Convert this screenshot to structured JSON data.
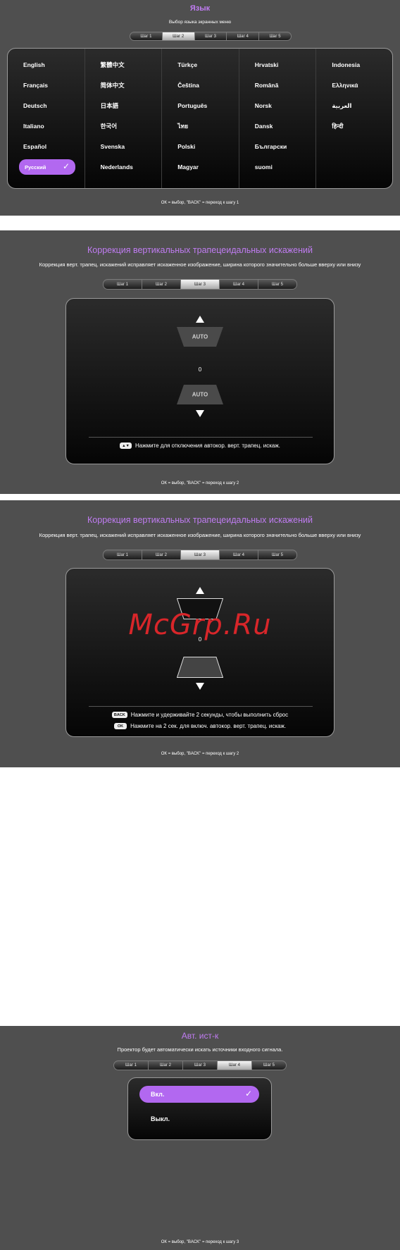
{
  "language_screen": {
    "title": "Язык",
    "subtitle": "Выбор языка экранных меню",
    "steps": [
      "Шаг 1",
      "Шаг 2",
      "Шаг 3",
      "Шаг 4",
      "Шаг 5"
    ],
    "active_step": 2,
    "columns": [
      [
        "English",
        "Français",
        "Deutsch",
        "Italiano",
        "Español",
        "Русский"
      ],
      [
        "繁體中文",
        "简体中文",
        "日本語",
        "한국어",
        "Svenska",
        "Nederlands"
      ],
      [
        "Türkçe",
        "Čeština",
        "Português",
        "ไทย",
        "Polski",
        "Magyar"
      ],
      [
        "Hrvatski",
        "Română",
        "Norsk",
        "Dansk",
        "Български",
        "suomi"
      ],
      [
        "Indonesia",
        "Ελληνικά",
        "العربية",
        "हिन्दी",
        "",
        ""
      ]
    ],
    "selected_language": "Русский",
    "footer": "ОК = выбор, \"BACK\" = переход к шагу 1"
  },
  "keystone_auto_screen": {
    "title": "Коррекция вертикальных трапецеидальных искажений",
    "subtitle": "Коррекция верт. трапец. искажений исправляет искаженное изображение, ширина которого значительно больше вверху или внизу",
    "steps": [
      "Шаг 1",
      "Шаг 2",
      "Шаг 3",
      "Шаг 4",
      "Шаг 5"
    ],
    "active_step": 3,
    "auto_top": "AUTO",
    "auto_bottom": "AUTO",
    "value": "0",
    "hint": "Нажмите для отключения автокор. верт. трапец. искаж.",
    "footer": "ОК = выбор, \"BACK\" = переход к шагу 2"
  },
  "keystone_manual_screen": {
    "title": "Коррекция вертикальных трапецеидальных искажений",
    "subtitle": "Коррекция верт. трапец. искажений исправляет искаженное изображение, ширина которого значительно больше вверху или внизу",
    "steps": [
      "Шаг 1",
      "Шаг 2",
      "Шаг 3",
      "Шаг 4",
      "Шаг 5"
    ],
    "active_step": 3,
    "value": "0",
    "watermark": "McGrp.Ru",
    "hint_back_key": "BACK",
    "hint_back": "Нажмите и удерживайте 2 секунды, чтобы выполнить сброс",
    "hint_ok_key": "OK",
    "hint_ok": "Нажмите на 2 сек. для включ. автокор. верт. трапец. искаж.",
    "footer": "ОК = выбор, \"BACK\" = переход к шагу 2"
  },
  "auto_source_screen": {
    "title": "Авт. ист-к",
    "subtitle": "Проектор будет автоматически искать источники входного сигнала.",
    "steps": [
      "Шаг 1",
      "Шаг 2",
      "Шаг 3",
      "Шаг 4",
      "Шаг 5"
    ],
    "active_step": 4,
    "options": [
      "Вкл.",
      "Выкл."
    ],
    "selected_option": "Вкл.",
    "footer": "ОК = выбор, \"BACK\" = переход к шагу 3"
  },
  "colors": {
    "accent": "#b268f0",
    "title": "#c07cf2",
    "panel_bg": "#4f4f4f",
    "watermark": "#d8262a"
  }
}
